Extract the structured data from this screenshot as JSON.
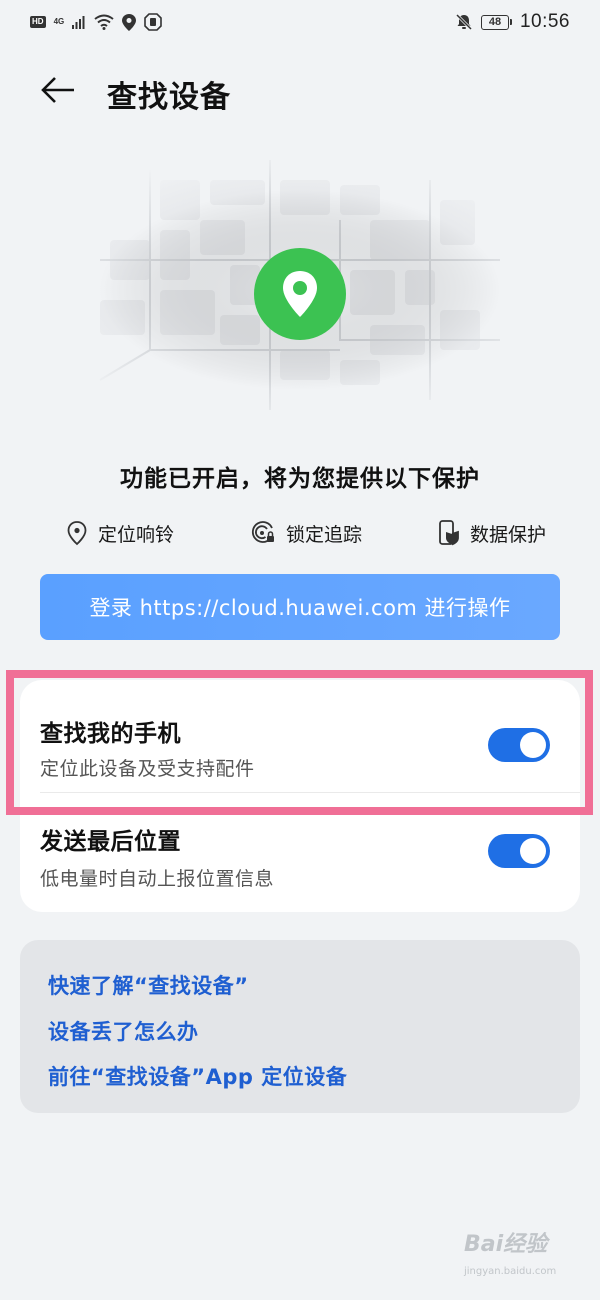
{
  "status_bar": {
    "hd": "HD",
    "network": "4G",
    "battery": "48",
    "time": "10:56",
    "icons": [
      "signal-icon",
      "wifi-icon",
      "location-icon",
      "shield-icon",
      "bell-muted-icon"
    ]
  },
  "header": {
    "title": "查找设备",
    "back_icon": "back-arrow-icon"
  },
  "hero": {
    "pin_color": "#3cc252",
    "icon": "location-pin-icon"
  },
  "protection": {
    "headline": "功能已开启，将为您提供以下保护",
    "features": [
      {
        "label": "定位响铃",
        "icon": "location-ring-icon"
      },
      {
        "label": "锁定追踪",
        "icon": "lock-track-icon"
      },
      {
        "label": "数据保护",
        "icon": "data-protect-icon"
      }
    ]
  },
  "cloud_button": {
    "label": "登录 https://cloud.huawei.com 进行操作",
    "color": "#5aa0ff"
  },
  "settings": [
    {
      "title": "查找我的手机",
      "description": "定位此设备及受支持配件",
      "enabled": true
    },
    {
      "title": "发送最后位置",
      "description": "低电量时自动上报位置信息",
      "enabled": true
    }
  ],
  "toggle_color": "#1f6fe5",
  "highlight_color": "#f06f96",
  "links": [
    {
      "label": "快速了解“查找设备”"
    },
    {
      "label": "设备丢了怎么办"
    },
    {
      "label": "前往“查找设备”App 定位设备"
    }
  ],
  "link_color": "#1f5fd1",
  "watermark": {
    "text": "Bai经验",
    "sub": "jingyan.baidu.com"
  }
}
